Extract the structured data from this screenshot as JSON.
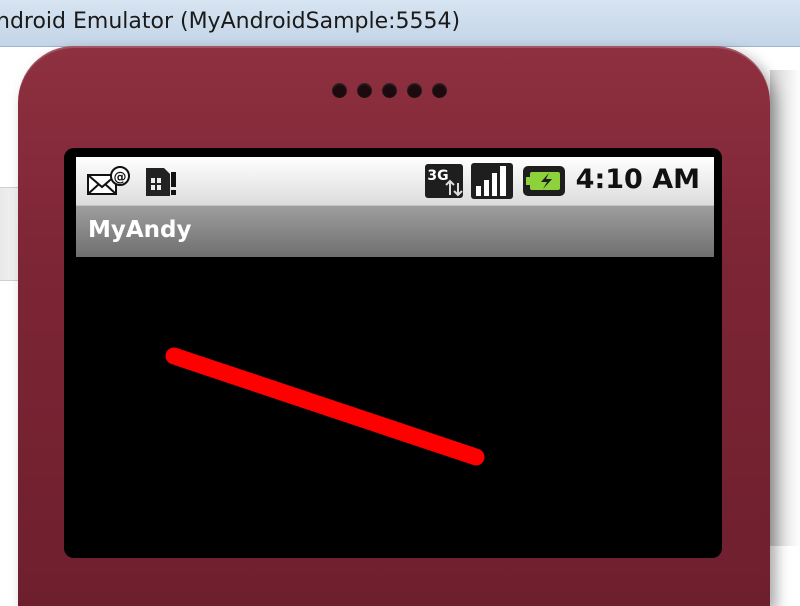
{
  "window": {
    "title": "ndroid Emulator (MyAndroidSample:5554)"
  },
  "status_bar": {
    "time": "4:10 AM",
    "icons": [
      "mail-at-icon",
      "sim-alert-icon",
      "3g-data-icon",
      "signal-icon",
      "battery-charging-icon"
    ],
    "network_label": "3G"
  },
  "app": {
    "title": "MyAndy",
    "line_color": "#ff0000",
    "background_color": "#000000"
  },
  "colors": {
    "device_body": "#7c2535",
    "title_bar": "#c8d9ec"
  }
}
